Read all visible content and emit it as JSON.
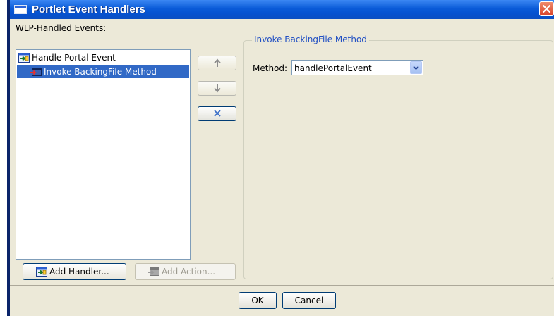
{
  "window": {
    "title": "Portlet Event Handlers",
    "accent_color": "#0a5bd8",
    "selection_color": "#3169c6"
  },
  "events": {
    "label": "WLP-Handled Events:",
    "tree": [
      {
        "label": "Handle Portal Event",
        "icon": "event-handler-icon"
      },
      {
        "label": "Invoke BackingFile Method",
        "icon": "action-icon",
        "selected": true
      }
    ]
  },
  "side_buttons": {
    "move_up": {
      "icon": "arrow-up-icon",
      "enabled": false
    },
    "move_down": {
      "icon": "arrow-down-icon",
      "enabled": false
    },
    "remove": {
      "icon": "close-x-icon",
      "enabled": true
    }
  },
  "buttons": {
    "add_handler": "Add Handler...",
    "add_action": "Add Action...",
    "ok": "OK",
    "cancel": "Cancel"
  },
  "detail": {
    "title": "Invoke BackingFile Method",
    "method_label": "Method:",
    "method_value": "handlePortalEvent"
  }
}
